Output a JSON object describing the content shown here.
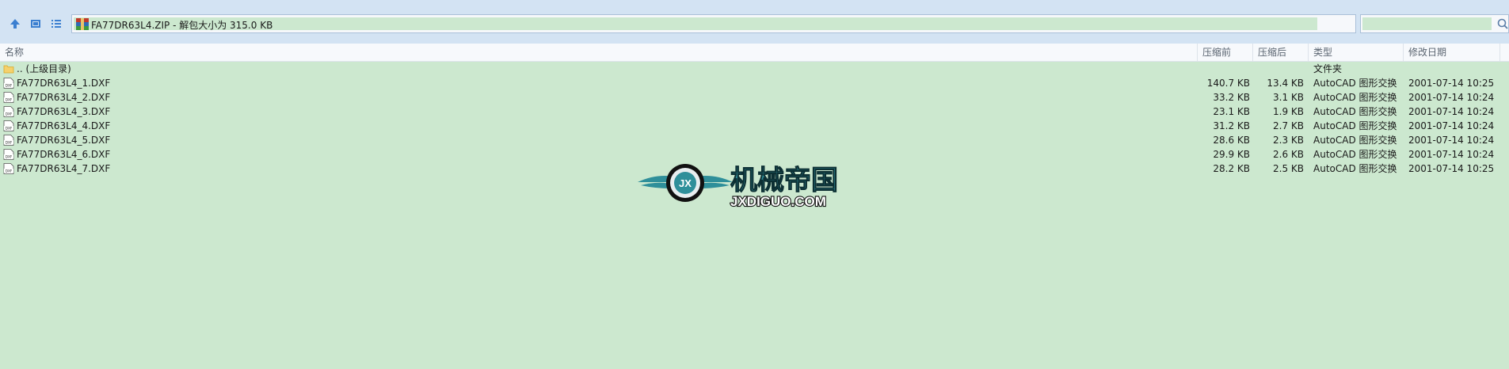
{
  "toolbar": {
    "address": "FA77DR63L4.ZIP - 解包大小为 315.0 KB",
    "search_placeholder": ""
  },
  "columns": {
    "name": "名称",
    "packed": "压缩前",
    "unpacked": "压缩后",
    "type": "类型",
    "date": "修改日期"
  },
  "parent": {
    "name": ".. (上级目录)",
    "type": "文件夹"
  },
  "files": [
    {
      "name": "FA77DR63L4_1.DXF",
      "packed": "140.7 KB",
      "unpacked": "13.4 KB",
      "type": "AutoCAD 图形交换",
      "date": "2001-07-14 10:25"
    },
    {
      "name": "FA77DR63L4_2.DXF",
      "packed": "33.2 KB",
      "unpacked": "3.1 KB",
      "type": "AutoCAD 图形交换",
      "date": "2001-07-14 10:24"
    },
    {
      "name": "FA77DR63L4_3.DXF",
      "packed": "23.1 KB",
      "unpacked": "1.9 KB",
      "type": "AutoCAD 图形交换",
      "date": "2001-07-14 10:24"
    },
    {
      "name": "FA77DR63L4_4.DXF",
      "packed": "31.2 KB",
      "unpacked": "2.7 KB",
      "type": "AutoCAD 图形交换",
      "date": "2001-07-14 10:24"
    },
    {
      "name": "FA77DR63L4_5.DXF",
      "packed": "28.6 KB",
      "unpacked": "2.3 KB",
      "type": "AutoCAD 图形交换",
      "date": "2001-07-14 10:24"
    },
    {
      "name": "FA77DR63L4_6.DXF",
      "packed": "29.9 KB",
      "unpacked": "2.6 KB",
      "type": "AutoCAD 图形交换",
      "date": "2001-07-14 10:24"
    },
    {
      "name": "FA77DR63L4_7.DXF",
      "packed": "28.2 KB",
      "unpacked": "2.5 KB",
      "type": "AutoCAD 图形交换",
      "date": "2001-07-14 10:25"
    }
  ],
  "watermark": {
    "title": "机械帝国",
    "url": "JXDIGUO.COM",
    "emblem": "JX"
  },
  "colors": {
    "background": "#cce8cf",
    "toolbar": "#d3e3f3",
    "accent": "#f0a30a",
    "logo_teal": "#2f8f9a"
  },
  "icons": [
    "up-arrow-icon",
    "view-icon",
    "list-icon",
    "archive-icon",
    "history-icon",
    "dropdown-icon",
    "search-icon",
    "folder-icon",
    "dxf-file-icon"
  ]
}
